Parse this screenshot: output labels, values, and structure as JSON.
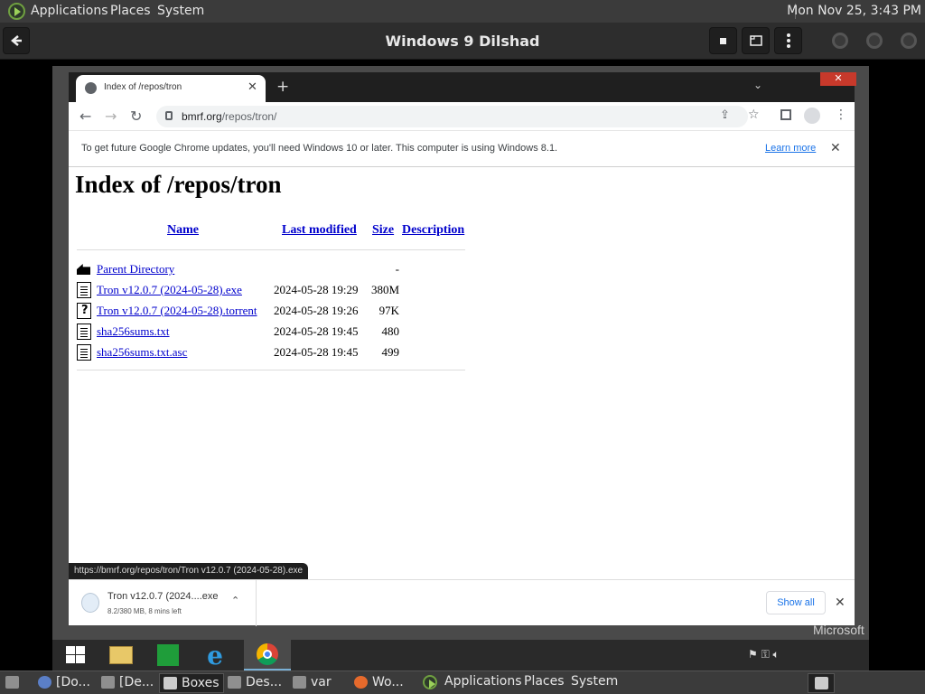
{
  "top_panel": {
    "menus": [
      "Applications",
      "Places",
      "System"
    ],
    "clock": "Mon Nov 25,  3:43 PM"
  },
  "boxes": {
    "title": "Windows 9  Dilshad"
  },
  "chrome": {
    "tab_title": "Index of /repos/tron",
    "url_host": "bmrf.org",
    "url_path": "/repos/tron/",
    "infobar_message": "To get future Google Chrome updates, you'll need Windows 10 or later. This computer is using Windows 8.1.",
    "infobar_link": "Learn more",
    "status_url": "https://bmrf.org/repos/tron/Tron v12.0.7 (2024-05-28).exe"
  },
  "listing": {
    "heading": "Index of /repos/tron",
    "columns": {
      "name": "Name",
      "modified": "Last modified",
      "size": "Size",
      "description": "Description"
    },
    "rows": [
      {
        "icon": "back-icon",
        "name": "Parent Directory",
        "modified": "",
        "size": "-"
      },
      {
        "icon": "binary-file-icon",
        "name": "Tron v12.0.7 (2024-05-28).exe",
        "modified": "2024-05-28 19:29",
        "size": "380M"
      },
      {
        "icon": "unknown-file-icon",
        "name": "Tron v12.0.7 (2024-05-28).torrent",
        "modified": "2024-05-28 19:26",
        "size": "97K"
      },
      {
        "icon": "text-file-icon",
        "name": "sha256sums.txt",
        "modified": "2024-05-28 19:45",
        "size": "480"
      },
      {
        "icon": "text-file-icon",
        "name": "sha256sums.txt.asc",
        "modified": "2024-05-28 19:45",
        "size": "499"
      }
    ]
  },
  "download_shelf": {
    "file_name": "Tron v12.0.7 (2024....exe",
    "progress": "8.2/380 MB, 8 mins left",
    "show_all": "Show all"
  },
  "windows_taskbar": {
    "watermark": "Microsoft",
    "apps": [
      "start-icon",
      "file-explorer-icon",
      "windows-store-icon",
      "internet-explorer-icon",
      "chrome-icon"
    ]
  },
  "bottom_panel": {
    "tasks": [
      "[Do...",
      "[De...",
      "Boxes",
      "Des...",
      "var",
      "Wo..."
    ],
    "menus": [
      "Applications",
      "Places",
      "System"
    ]
  },
  "colors": {
    "link": "#0000cc",
    "chrome_link": "#1a73e8",
    "panel": "#3b3b3b"
  }
}
